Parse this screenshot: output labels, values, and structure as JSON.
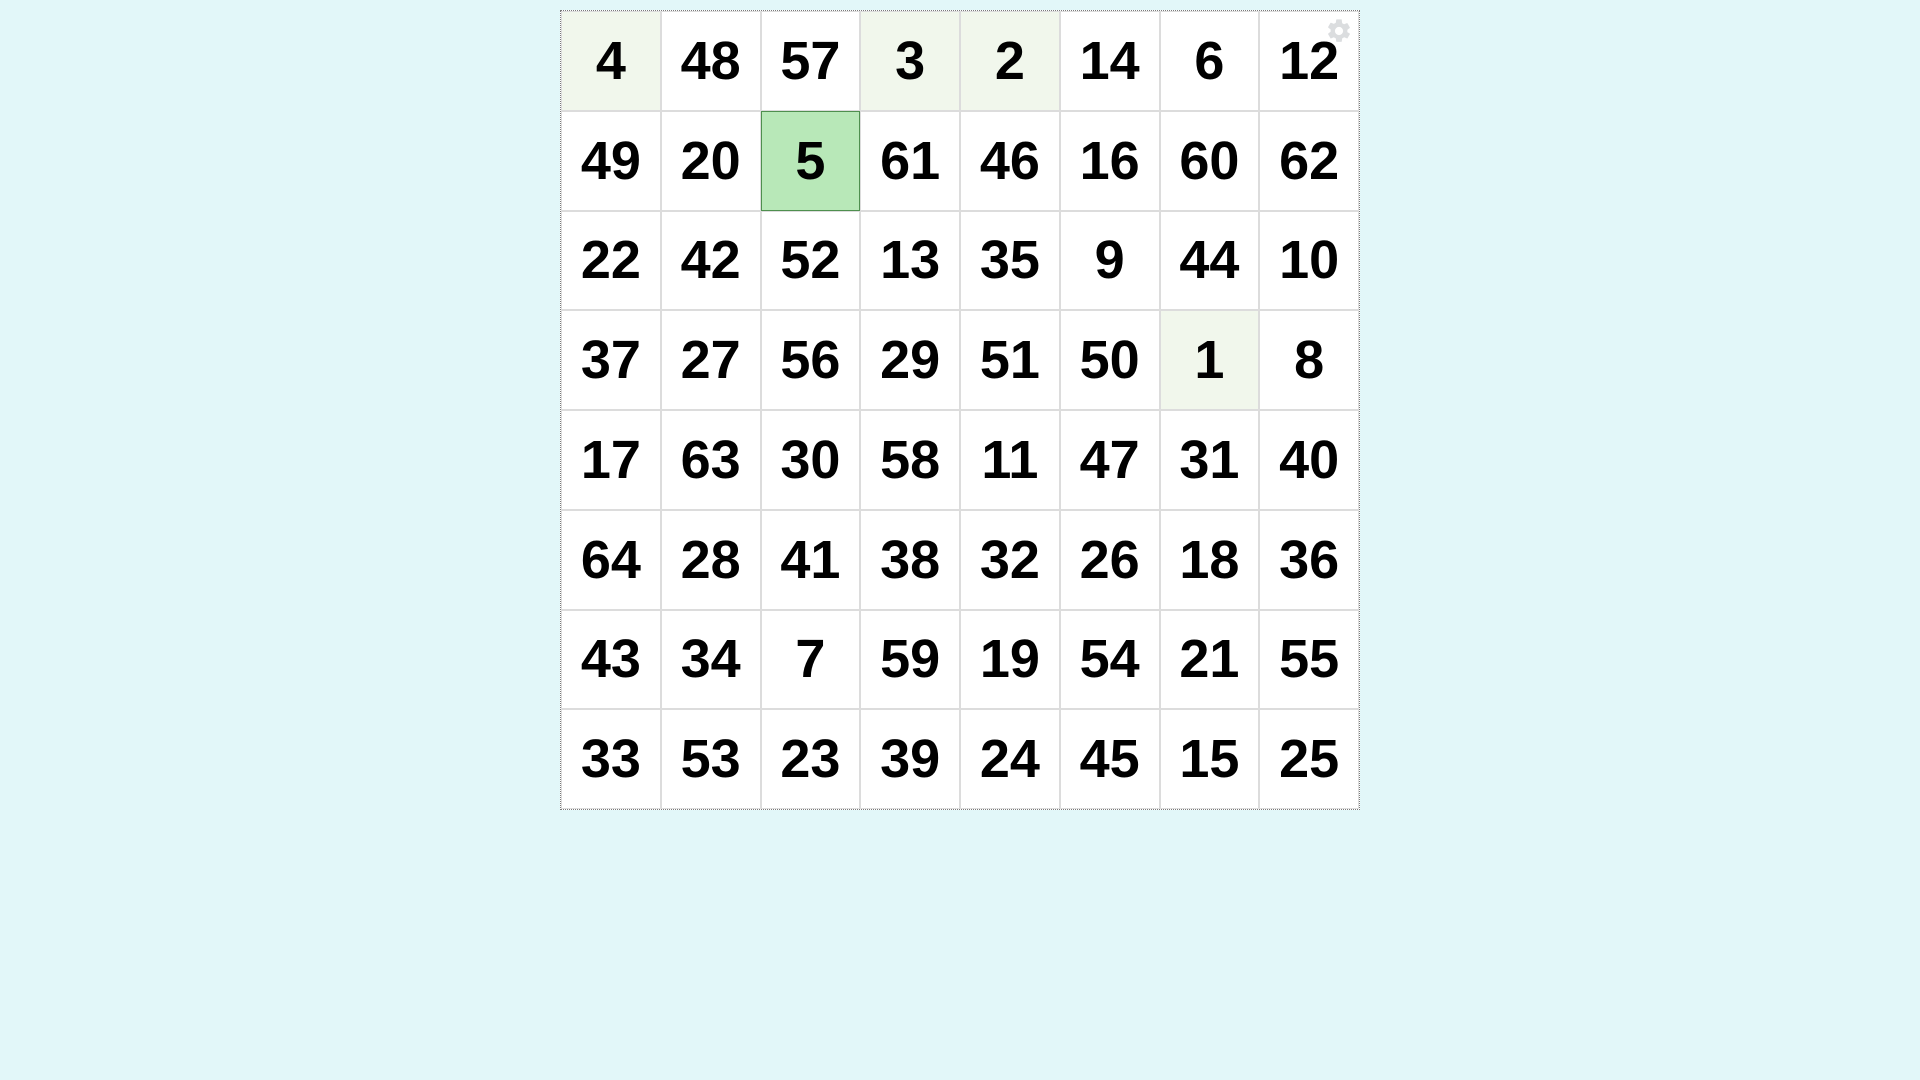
{
  "game": {
    "rows": 8,
    "cols": 8,
    "grid": [
      [
        4,
        48,
        57,
        3,
        2,
        14,
        6,
        12
      ],
      [
        49,
        20,
        5,
        61,
        46,
        16,
        60,
        62
      ],
      [
        22,
        42,
        52,
        13,
        35,
        9,
        44,
        10
      ],
      [
        37,
        27,
        56,
        29,
        51,
        50,
        1,
        8
      ],
      [
        17,
        63,
        30,
        58,
        11,
        47,
        31,
        40
      ],
      [
        64,
        28,
        41,
        38,
        32,
        26,
        18,
        36
      ],
      [
        43,
        34,
        7,
        59,
        19,
        54,
        21,
        55
      ],
      [
        33,
        53,
        23,
        39,
        24,
        45,
        15,
        25
      ]
    ],
    "found_values": [
      1,
      2,
      3,
      4
    ],
    "current_value": 5
  },
  "icons": {
    "settings": "gear-icon"
  }
}
